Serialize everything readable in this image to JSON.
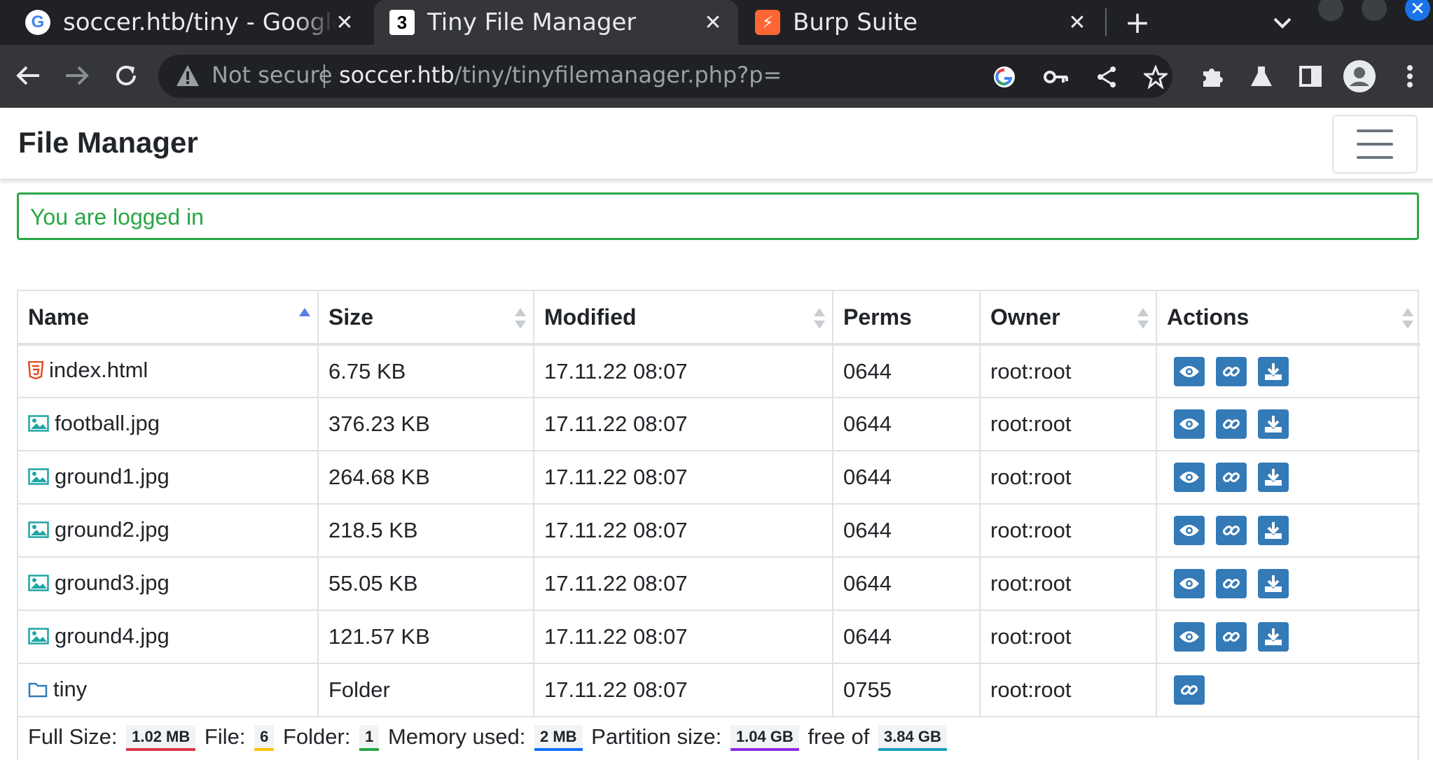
{
  "browser": {
    "tabs": [
      {
        "title": "soccer.htb/tiny - Google S",
        "favicon": "google-icon",
        "active": false
      },
      {
        "title": "Tiny File Manager",
        "favicon": "tinyfilemanager-icon",
        "active": true
      },
      {
        "title": "Burp Suite",
        "favicon": "burp-icon",
        "active": false
      }
    ],
    "tab_favicon_letters": [
      "G",
      "3",
      "⚡"
    ],
    "close_glyph": "✕",
    "new_tab_glyph": "+",
    "security_label": "Not secure",
    "url_host": "soccer.htb",
    "url_path": "/tiny/tinyfilemanager.php?p="
  },
  "page": {
    "brand": "File Manager",
    "alert": "You are logged in",
    "columns": [
      "Name",
      "Size",
      "Modified",
      "Perms",
      "Owner",
      "Actions"
    ],
    "files": [
      {
        "name": "index.html",
        "type": "html",
        "size": "6.75 KB",
        "modified": "17.11.22 08:07",
        "perms": "0644",
        "owner": "root:root"
      },
      {
        "name": "football.jpg",
        "type": "image",
        "size": "376.23 KB",
        "modified": "17.11.22 08:07",
        "perms": "0644",
        "owner": "root:root"
      },
      {
        "name": "ground1.jpg",
        "type": "image",
        "size": "264.68 KB",
        "modified": "17.11.22 08:07",
        "perms": "0644",
        "owner": "root:root"
      },
      {
        "name": "ground2.jpg",
        "type": "image",
        "size": "218.5 KB",
        "modified": "17.11.22 08:07",
        "perms": "0644",
        "owner": "root:root"
      },
      {
        "name": "ground3.jpg",
        "type": "image",
        "size": "55.05 KB",
        "modified": "17.11.22 08:07",
        "perms": "0644",
        "owner": "root:root"
      },
      {
        "name": "ground4.jpg",
        "type": "image",
        "size": "121.57 KB",
        "modified": "17.11.22 08:07",
        "perms": "0644",
        "owner": "root:root"
      },
      {
        "name": "tiny",
        "type": "folder",
        "size": "Folder",
        "modified": "17.11.22 08:07",
        "perms": "0755",
        "owner": "root:root"
      }
    ],
    "footer": {
      "full_size_label": "Full Size:",
      "full_size": "1.02 MB",
      "file_label": "File:",
      "file_count": "6",
      "folder_label": "Folder:",
      "folder_count": "1",
      "memory_label": "Memory used:",
      "memory": "2 MB",
      "partition_label": "Partition size:",
      "partition_free": "1.04 GB",
      "free_of_label": "free of",
      "partition_total": "3.84 GB"
    }
  },
  "colors": {
    "success": "#28a745",
    "action_button": "#337ab7",
    "badge_full_size": "#dc3545",
    "badge_file": "#ffc107",
    "badge_folder": "#28a745",
    "badge_memory": "#0d6efd",
    "badge_partition_free": "#8a2be2",
    "badge_partition_total": "#17a2b8"
  }
}
